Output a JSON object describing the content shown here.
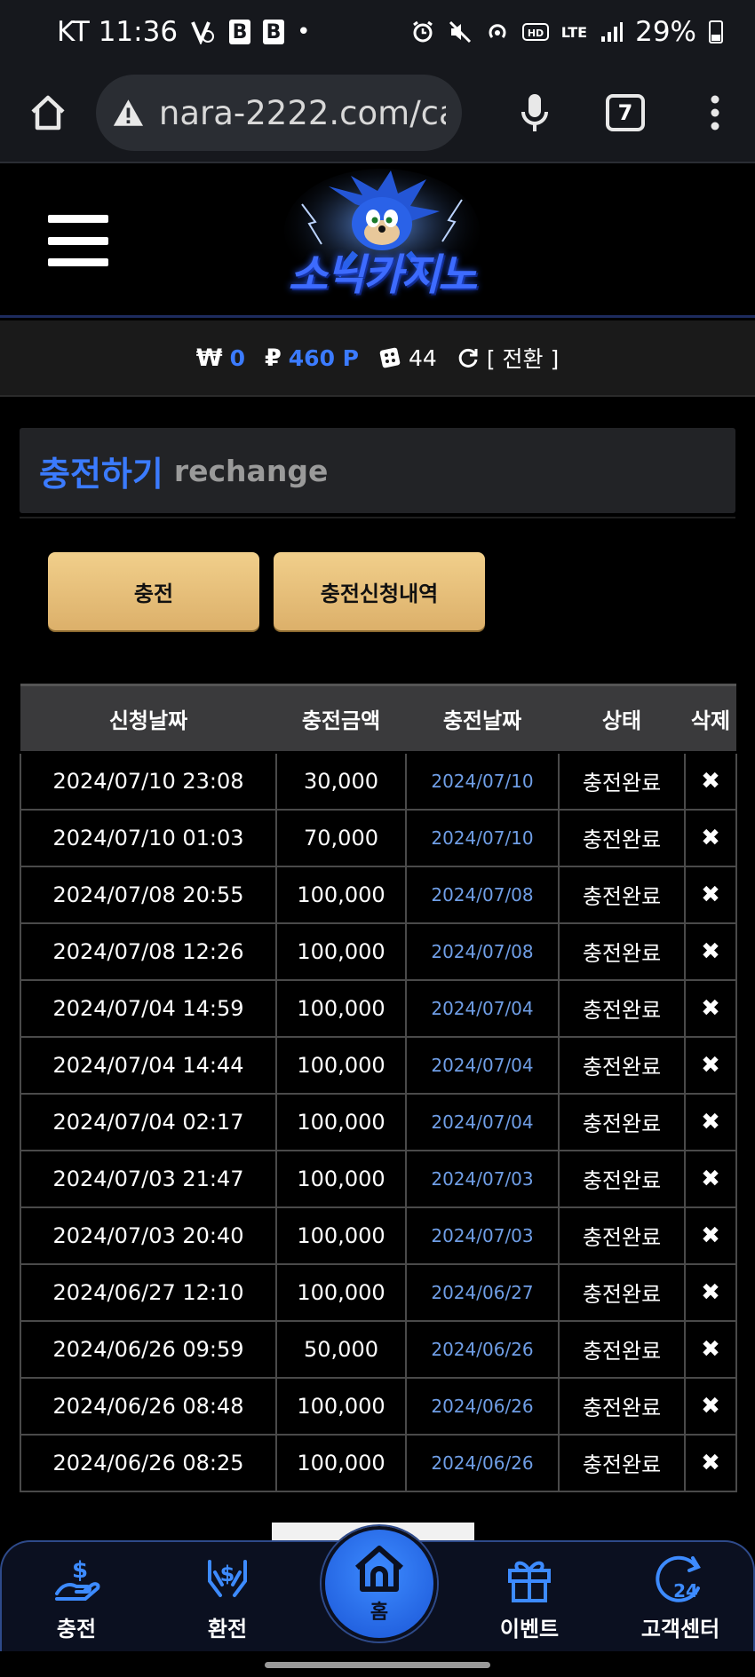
{
  "status_bar": {
    "carrier_time": "KT 11:36",
    "badges": [
      "B",
      "B"
    ],
    "dot": "•",
    "network": "LTE",
    "battery": "29%"
  },
  "browser": {
    "url": "nara-2222.com/ca:",
    "tab_count": "7"
  },
  "site": {
    "logo_text": "소닉카지노"
  },
  "balance": {
    "won_symbol": "₩",
    "won_value": "0",
    "point_symbol": "₽",
    "point_value": "460 P",
    "chip_value": "44",
    "switch_label": "[ 전환 ]"
  },
  "section": {
    "title_ko": "충전하기",
    "title_en": "rechange"
  },
  "buttons": {
    "charge": "충전",
    "history": "충전신청내역"
  },
  "table": {
    "headers": [
      "신청날짜",
      "충전금액",
      "충전날짜",
      "상태",
      "삭제"
    ],
    "rows": [
      [
        "2024/07/10 23:08",
        "30,000",
        "2024/07/10",
        "충전완료",
        "✖"
      ],
      [
        "2024/07/10 01:03",
        "70,000",
        "2024/07/10",
        "충전완료",
        "✖"
      ],
      [
        "2024/07/08 20:55",
        "100,000",
        "2024/07/08",
        "충전완료",
        "✖"
      ],
      [
        "2024/07/08 12:26",
        "100,000",
        "2024/07/08",
        "충전완료",
        "✖"
      ],
      [
        "2024/07/04 14:59",
        "100,000",
        "2024/07/04",
        "충전완료",
        "✖"
      ],
      [
        "2024/07/04 14:44",
        "100,000",
        "2024/07/04",
        "충전완료",
        "✖"
      ],
      [
        "2024/07/04 02:17",
        "100,000",
        "2024/07/04",
        "충전완료",
        "✖"
      ],
      [
        "2024/07/03 21:47",
        "100,000",
        "2024/07/03",
        "충전완료",
        "✖"
      ],
      [
        "2024/07/03 20:40",
        "100,000",
        "2024/07/03",
        "충전완료",
        "✖"
      ],
      [
        "2024/06/27 12:10",
        "100,000",
        "2024/06/27",
        "충전완료",
        "✖"
      ],
      [
        "2024/06/26 09:59",
        "50,000",
        "2024/06/26",
        "충전완료",
        "✖"
      ],
      [
        "2024/06/26 08:48",
        "100,000",
        "2024/06/26",
        "충전완료",
        "✖"
      ],
      [
        "2024/06/26 08:25",
        "100,000",
        "2024/06/26",
        "충전완료",
        "✖"
      ]
    ]
  },
  "bottom_nav": {
    "items": [
      {
        "label": "충전",
        "icon": "hand-coin-icon"
      },
      {
        "label": "환전",
        "icon": "hands-dollar-icon"
      },
      {
        "label": "홈",
        "icon": "home-icon"
      },
      {
        "label": "이벤트",
        "icon": "gift-icon"
      },
      {
        "label": "고객센터",
        "icon": "support-24-icon"
      }
    ]
  },
  "colors": {
    "accent_blue": "#3b7bff",
    "gold_button": "#e6c07a",
    "date_blue": "#6f9ee6"
  }
}
